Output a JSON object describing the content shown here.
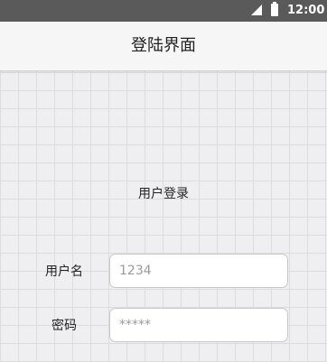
{
  "status_bar": {
    "time": "12:00",
    "icons": [
      "signal-icon",
      "battery-icon"
    ]
  },
  "header": {
    "title": "登陆界面"
  },
  "login": {
    "heading": "用户登录",
    "username": {
      "label": "用户名",
      "placeholder": "1234",
      "value": ""
    },
    "password": {
      "label": "密码",
      "placeholder": "*****",
      "value": ""
    }
  },
  "colors": {
    "status_bar_bg": "#5a5a5a",
    "app_bar_bg": "#f6f6f6",
    "page_bg": "#efeff1",
    "input_border": "#c8c8c8"
  }
}
